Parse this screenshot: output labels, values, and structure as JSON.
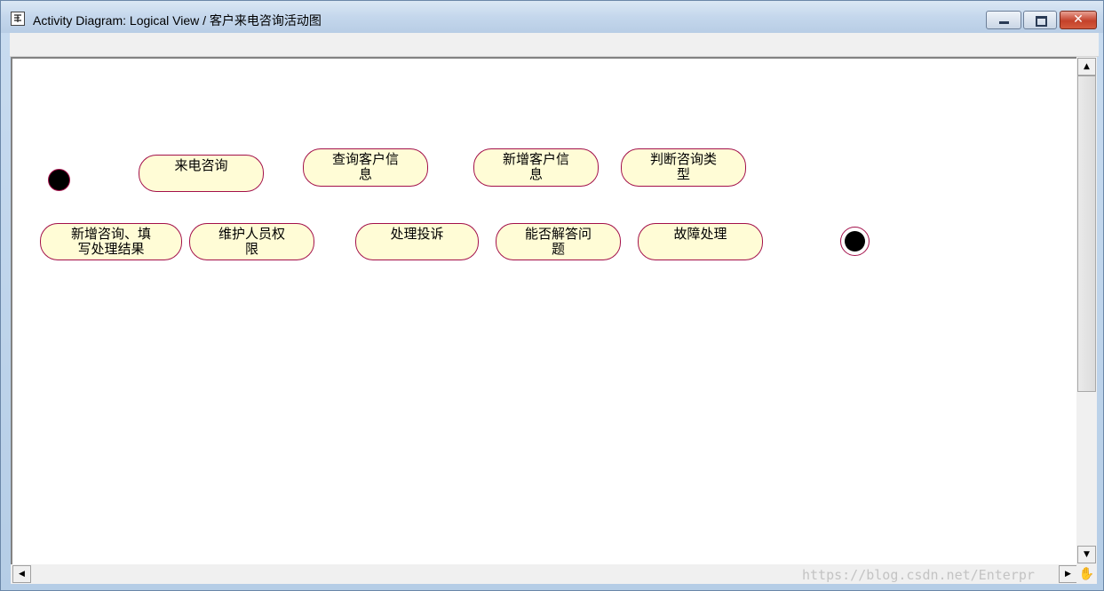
{
  "window": {
    "title": "Activity Diagram: Logical View / 客户来电咨询活动图",
    "close_glyph": "✕",
    "icons": {
      "app": "activity-diagram-icon",
      "minimize": "minimize-icon",
      "maximize": "maximize-icon",
      "close": "close-icon"
    }
  },
  "diagram": {
    "activities": [
      {
        "label": "来电咨询"
      },
      {
        "label": "查询客户信\n息"
      },
      {
        "label": "新增客户信\n息"
      },
      {
        "label": "判断咨询类\n型"
      },
      {
        "label": "新增咨询、填\n写处理结果"
      },
      {
        "label": "维护人员权\n限"
      },
      {
        "label": "处理投诉"
      },
      {
        "label": "能否解答问\n题"
      },
      {
        "label": "故障处理"
      }
    ]
  },
  "scrollbars": {
    "up_glyph": "▲",
    "down_glyph": "▼",
    "left_glyph": "◀",
    "right_glyph": "▶",
    "corner_glyph": "✋"
  },
  "watermark": "https://blog.csdn.net/Enterpr"
}
